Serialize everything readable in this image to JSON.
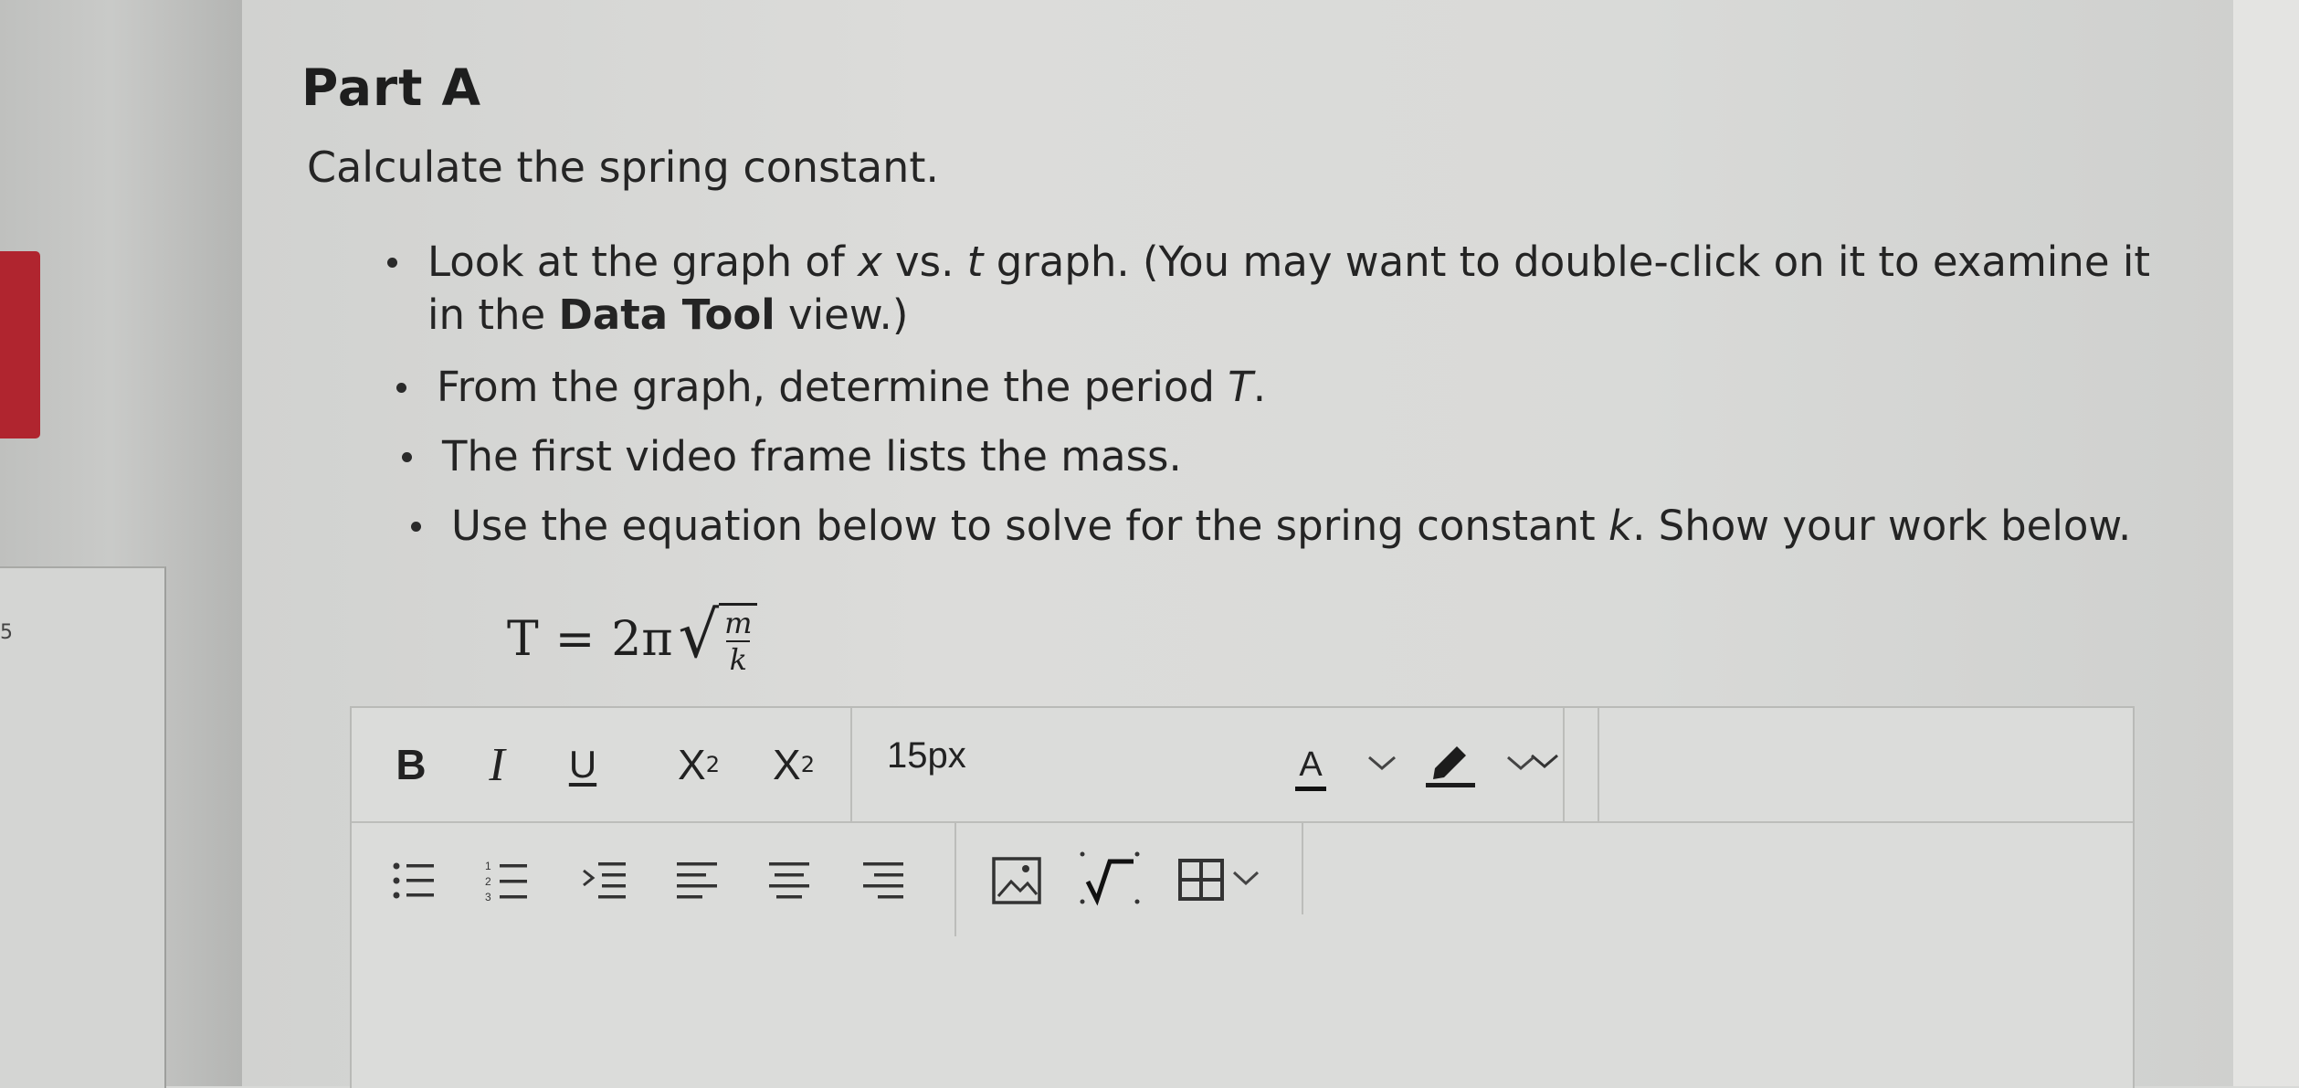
{
  "part": {
    "title": "Part A",
    "prompt": "Calculate the spring constant."
  },
  "bullets": [
    {
      "before_italic": "Look at the graph of ",
      "italic1": "x",
      "middle": " vs. ",
      "italic2": "t",
      "after": " graph. (You may want to double-click on it to examine it",
      "line2_before": "in the ",
      "bold": "Data Tool",
      "line2_after": " view.)"
    },
    {
      "before": "From the graph, determine the period ",
      "italic": "T",
      "after": "."
    },
    {
      "text": "The first video frame lists the mass."
    },
    {
      "before": "Use the equation below to solve for the spring constant ",
      "italic": "k",
      "after": ". Show your work below."
    }
  ],
  "equation": {
    "lhs": "T",
    "equals": "=",
    "coefficient": "2π",
    "numerator": "m",
    "denominator": "k"
  },
  "toolbar": {
    "bold_label": "B",
    "italic_label": "I",
    "underline_label": "U",
    "superscript_base": "X",
    "superscript_exp": "2",
    "subscript_base": "X",
    "subscript_sub": "2",
    "font_size": "15px",
    "font_color_label": "A",
    "icons": [
      "bold-icon",
      "italic-icon",
      "underline-icon",
      "superscript-icon",
      "subscript-icon",
      "chevron-down-icon",
      "font-color-icon",
      "highlight-icon",
      "bullet-list-icon",
      "numbered-list-icon",
      "indent-icon",
      "align-left-icon",
      "align-center-icon",
      "align-right-icon",
      "image-icon",
      "math-equation-icon",
      "table-icon"
    ]
  },
  "left_panel": {
    "marker": "5"
  }
}
